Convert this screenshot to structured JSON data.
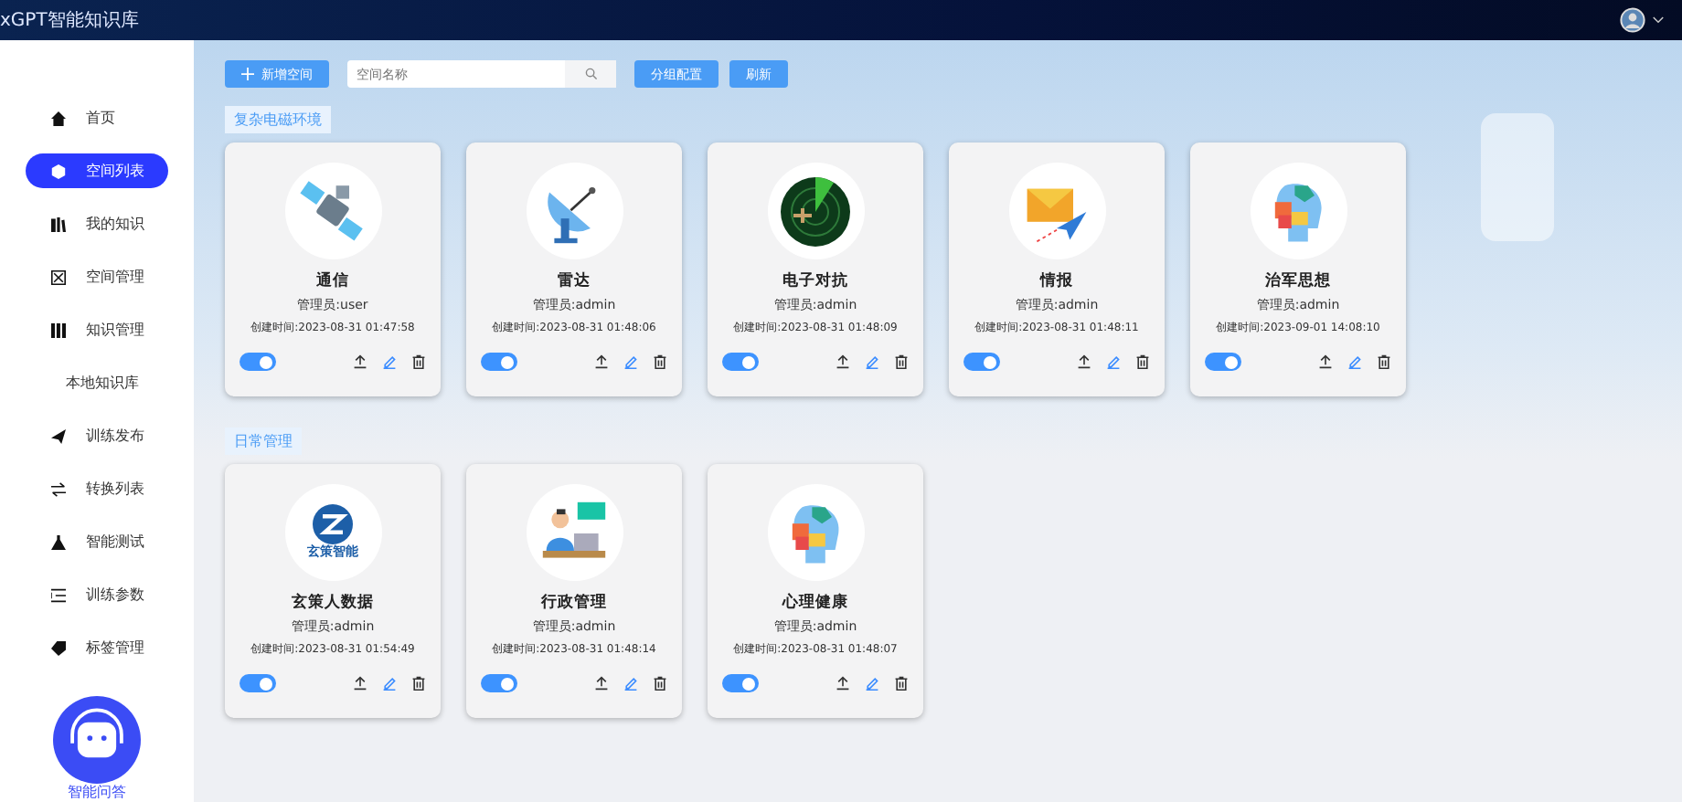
{
  "header": {
    "title": "xGPT智能知识库"
  },
  "sidebar": {
    "items": [
      {
        "label": "首页",
        "selected": false
      },
      {
        "label": "空间列表",
        "selected": true
      },
      {
        "label": "我的知识",
        "selected": false
      },
      {
        "label": "空间管理",
        "selected": false
      },
      {
        "label": "知识管理",
        "selected": false,
        "children": [
          {
            "label": "本地知识库",
            "selected": false
          }
        ]
      },
      {
        "label": "训练发布",
        "selected": false
      },
      {
        "label": "转换列表",
        "selected": false
      },
      {
        "label": "智能测试",
        "selected": false
      },
      {
        "label": "训练参数",
        "selected": false
      },
      {
        "label": "标签管理",
        "selected": false
      }
    ],
    "assistant": {
      "label": "智能问答"
    }
  },
  "toolbar": {
    "add_button": "新增空间",
    "search": {
      "placeholder": "空间名称"
    },
    "group_button": "分组配置",
    "refresh_button": "刷新"
  },
  "groups": [
    {
      "name": "复杂电磁环境",
      "cards": [
        {
          "title": "通信",
          "admin": "管理员:user",
          "created": "创建时间:2023-08-31 01:47:58",
          "enabled": true
        },
        {
          "title": "雷达",
          "admin": "管理员:admin",
          "created": "创建时间:2023-08-31 01:48:06",
          "enabled": true
        },
        {
          "title": "电子对抗",
          "admin": "管理员:admin",
          "created": "创建时间:2023-08-31 01:48:09",
          "enabled": true
        },
        {
          "title": "情报",
          "admin": "管理员:admin",
          "created": "创建时间:2023-08-31 01:48:11",
          "enabled": true
        },
        {
          "title": "治军思想",
          "admin": "管理员:admin",
          "created": "创建时间:2023-09-01 14:08:10",
          "enabled": true
        }
      ]
    },
    {
      "name": "日常管理",
      "cards": [
        {
          "title": "玄策人数据",
          "logo_text": "玄策智能",
          "admin": "管理员:admin",
          "created": "创建时间:2023-08-31 01:54:49",
          "enabled": true
        },
        {
          "title": "行政管理",
          "admin": "管理员:admin",
          "created": "创建时间:2023-08-31 01:48:14",
          "enabled": true
        },
        {
          "title": "心理健康",
          "admin": "管理员:admin",
          "created": "创建时间:2023-08-31 01:48:07",
          "enabled": true
        }
      ]
    }
  ]
}
